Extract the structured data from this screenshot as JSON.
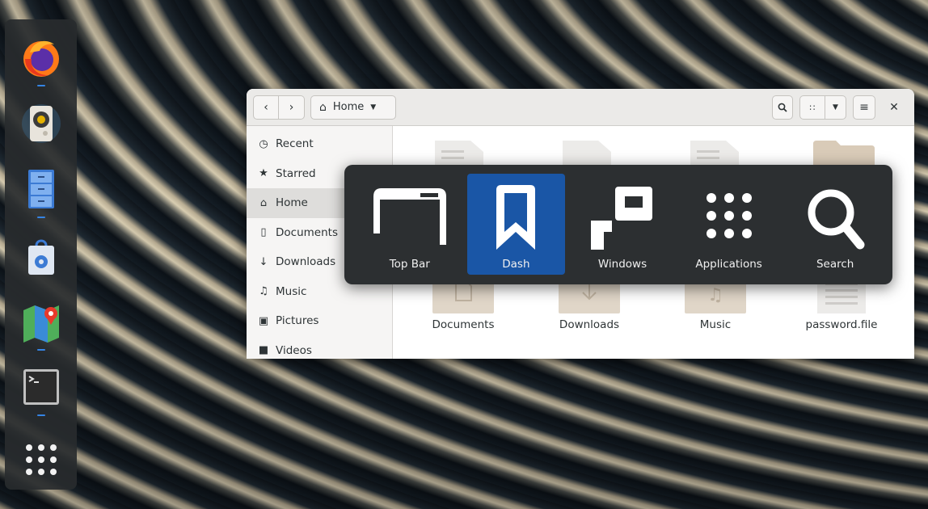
{
  "dock": {
    "apps": [
      {
        "name": "firefox",
        "running": true
      },
      {
        "name": "rhythmbox",
        "running": false
      },
      {
        "name": "files",
        "running": true
      },
      {
        "name": "software",
        "running": false
      },
      {
        "name": "maps",
        "running": true
      },
      {
        "name": "terminal",
        "running": true
      }
    ]
  },
  "file_manager": {
    "path": "Home",
    "sidebar": [
      {
        "label": "Recent",
        "icon": "clock-icon"
      },
      {
        "label": "Starred",
        "icon": "star-icon"
      },
      {
        "label": "Home",
        "icon": "home-icon",
        "active": true
      },
      {
        "label": "Documents",
        "icon": "document-icon"
      },
      {
        "label": "Downloads",
        "icon": "download-icon"
      },
      {
        "label": "Music",
        "icon": "music-note-icon"
      },
      {
        "label": "Pictures",
        "icon": "camera-icon"
      },
      {
        "label": "Videos",
        "icon": "video-icon"
      }
    ],
    "files": [
      {
        "label": "Documents"
      },
      {
        "label": "Downloads"
      },
      {
        "label": "Music"
      },
      {
        "label": "password.file"
      }
    ]
  },
  "switcher": {
    "items": [
      {
        "label": "Top Bar"
      },
      {
        "label": "Dash",
        "selected": true
      },
      {
        "label": "Windows"
      },
      {
        "label": "Applications"
      },
      {
        "label": "Search"
      }
    ],
    "accent": "#1a56a6"
  }
}
